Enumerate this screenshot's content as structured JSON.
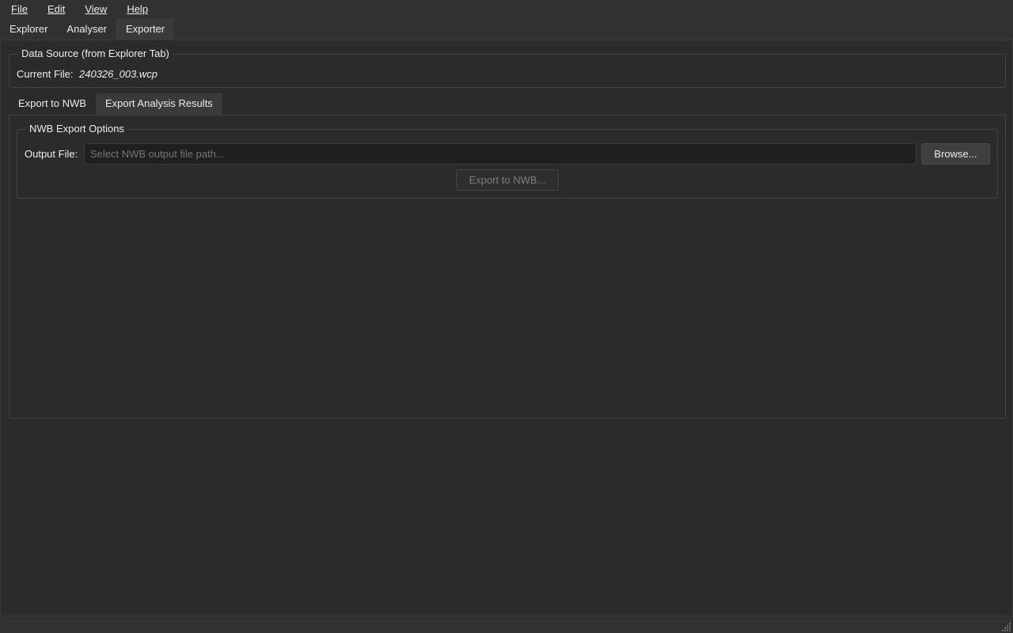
{
  "menubar": {
    "items": [
      {
        "label": "File"
      },
      {
        "label": "Edit"
      },
      {
        "label": "View"
      },
      {
        "label": "Help"
      }
    ]
  },
  "main_tabs": {
    "items": [
      {
        "label": "Explorer"
      },
      {
        "label": "Analyser"
      },
      {
        "label": "Exporter"
      }
    ],
    "active": "Exporter"
  },
  "data_source": {
    "title": "Data Source (from Explorer Tab)",
    "current_file_label": "Current File:",
    "current_file_value": "240326_003.wcp"
  },
  "sub_tabs": {
    "items": [
      {
        "label": "Export to NWB"
      },
      {
        "label": "Export Analysis Results"
      }
    ],
    "active": "Export Analysis Results"
  },
  "nwb_options": {
    "title": "NWB Export Options",
    "output_label": "Output File:",
    "output_value": "",
    "output_placeholder": "Select NWB output file path...",
    "browse_label": "Browse...",
    "export_label": "Export to NWB..."
  },
  "icons": {
    "size_grip": "size-grip-icon"
  }
}
